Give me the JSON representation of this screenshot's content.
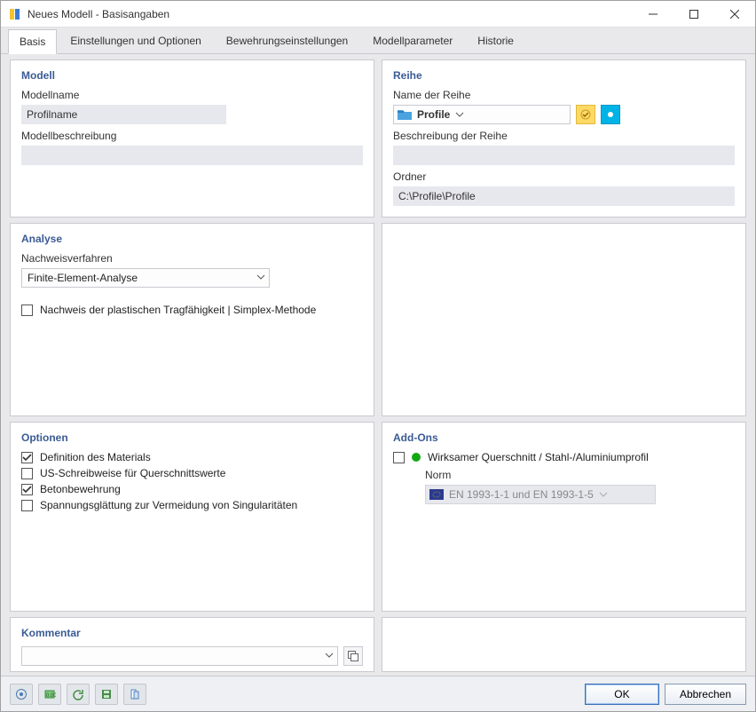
{
  "window": {
    "title": "Neues Modell - Basisangaben"
  },
  "tabs": [
    "Basis",
    "Einstellungen und Optionen",
    "Bewehrungseinstellungen",
    "Modellparameter",
    "Historie"
  ],
  "active_tab_index": 0,
  "modell": {
    "heading": "Modell",
    "name_label": "Modellname",
    "name_value": "Profilname",
    "desc_label": "Modellbeschreibung",
    "desc_value": ""
  },
  "reihe": {
    "heading": "Reihe",
    "name_label": "Name der Reihe",
    "series_value": "Profile",
    "desc_label": "Beschreibung der Reihe",
    "desc_value": "",
    "folder_label": "Ordner",
    "folder_value": "C:\\Profile\\Profile"
  },
  "analyse": {
    "heading": "Analyse",
    "method_label": "Nachweisverfahren",
    "method_value": "Finite-Element-Analyse",
    "plastic_label": "Nachweis der plastischen Tragfähigkeit | Simplex-Methode",
    "plastic_checked": false
  },
  "optionen": {
    "heading": "Optionen",
    "items": [
      {
        "label": "Definition des Materials",
        "checked": true
      },
      {
        "label": "US-Schreibweise für Querschnittswerte",
        "checked": false
      },
      {
        "label": "Betonbewehrung",
        "checked": true
      },
      {
        "label": "Spannungsglättung zur Vermeidung von Singularitäten",
        "checked": false
      }
    ]
  },
  "addons": {
    "heading": "Add-Ons",
    "eff_label": "Wirksamer Querschnitt / Stahl-/Aluminiumprofil",
    "eff_checked": false,
    "norm_label": "Norm",
    "norm_value": "EN 1993-1-1 und EN 1993-1-5"
  },
  "kommentar": {
    "heading": "Kommentar",
    "value": ""
  },
  "buttons": {
    "ok": "OK",
    "cancel": "Abbrechen"
  }
}
